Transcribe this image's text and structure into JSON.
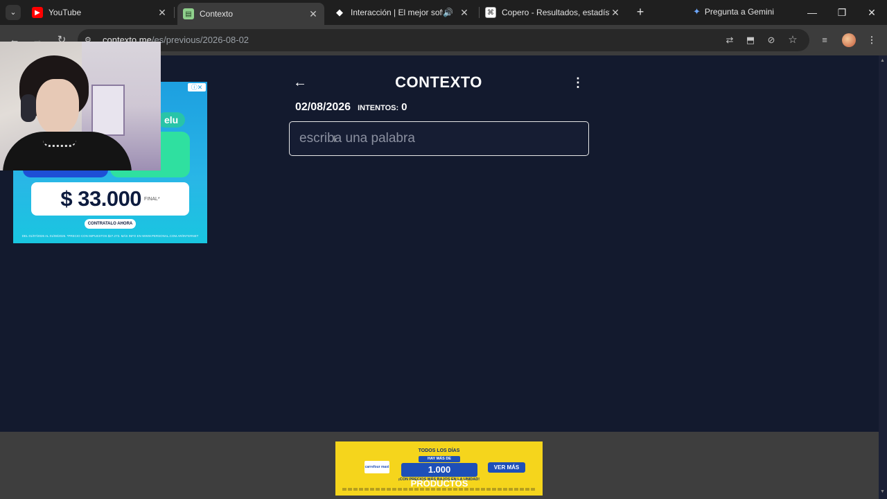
{
  "browser": {
    "tabs": [
      {
        "title": "YouTube",
        "favicon": "youtube-icon",
        "active": false
      },
      {
        "title": "Contexto",
        "favicon": "contexto-icon",
        "active": true
      },
      {
        "title": "Interacción | El mejor software",
        "favicon": "interaccion-icon",
        "active": false,
        "audio": true
      },
      {
        "title": "Copero - Resultados, estadísticas",
        "favicon": "copero-icon",
        "active": false
      }
    ],
    "gemini_label": "Pregunta a Gemini",
    "url_host": "contexto.me",
    "url_path": "/es/previous/2026-08-02"
  },
  "game": {
    "title": "CONTEXTO",
    "date": "02/08/2026",
    "attempts_label": "INTENTOS:",
    "attempts": "0",
    "input_placeholder": "escriba una palabra"
  },
  "ad_left": {
    "badge": "elu",
    "price": "$ 33.000",
    "price_suffix": "FINAL*",
    "cta": "CONTRATALO AHORA",
    "fine_print": "DEL 01/07/2026 AL 01/08/2026. *PRECIO CON IMPUESTOS $27.273. MÁS INFO EN WWW.PERSONAL.COM.AR/INTERNET"
  },
  "ad_bottom": {
    "line1": "TODOS LOS DÍAS",
    "line2": "HAY MÁS DE",
    "line3": "1.000 PRODUCTOS",
    "line4": "¡CON PRECIOS MÁS BAJOS EN LA UNIDAD!",
    "logo": "carrefour maxi",
    "button": "VER MÁS"
  }
}
